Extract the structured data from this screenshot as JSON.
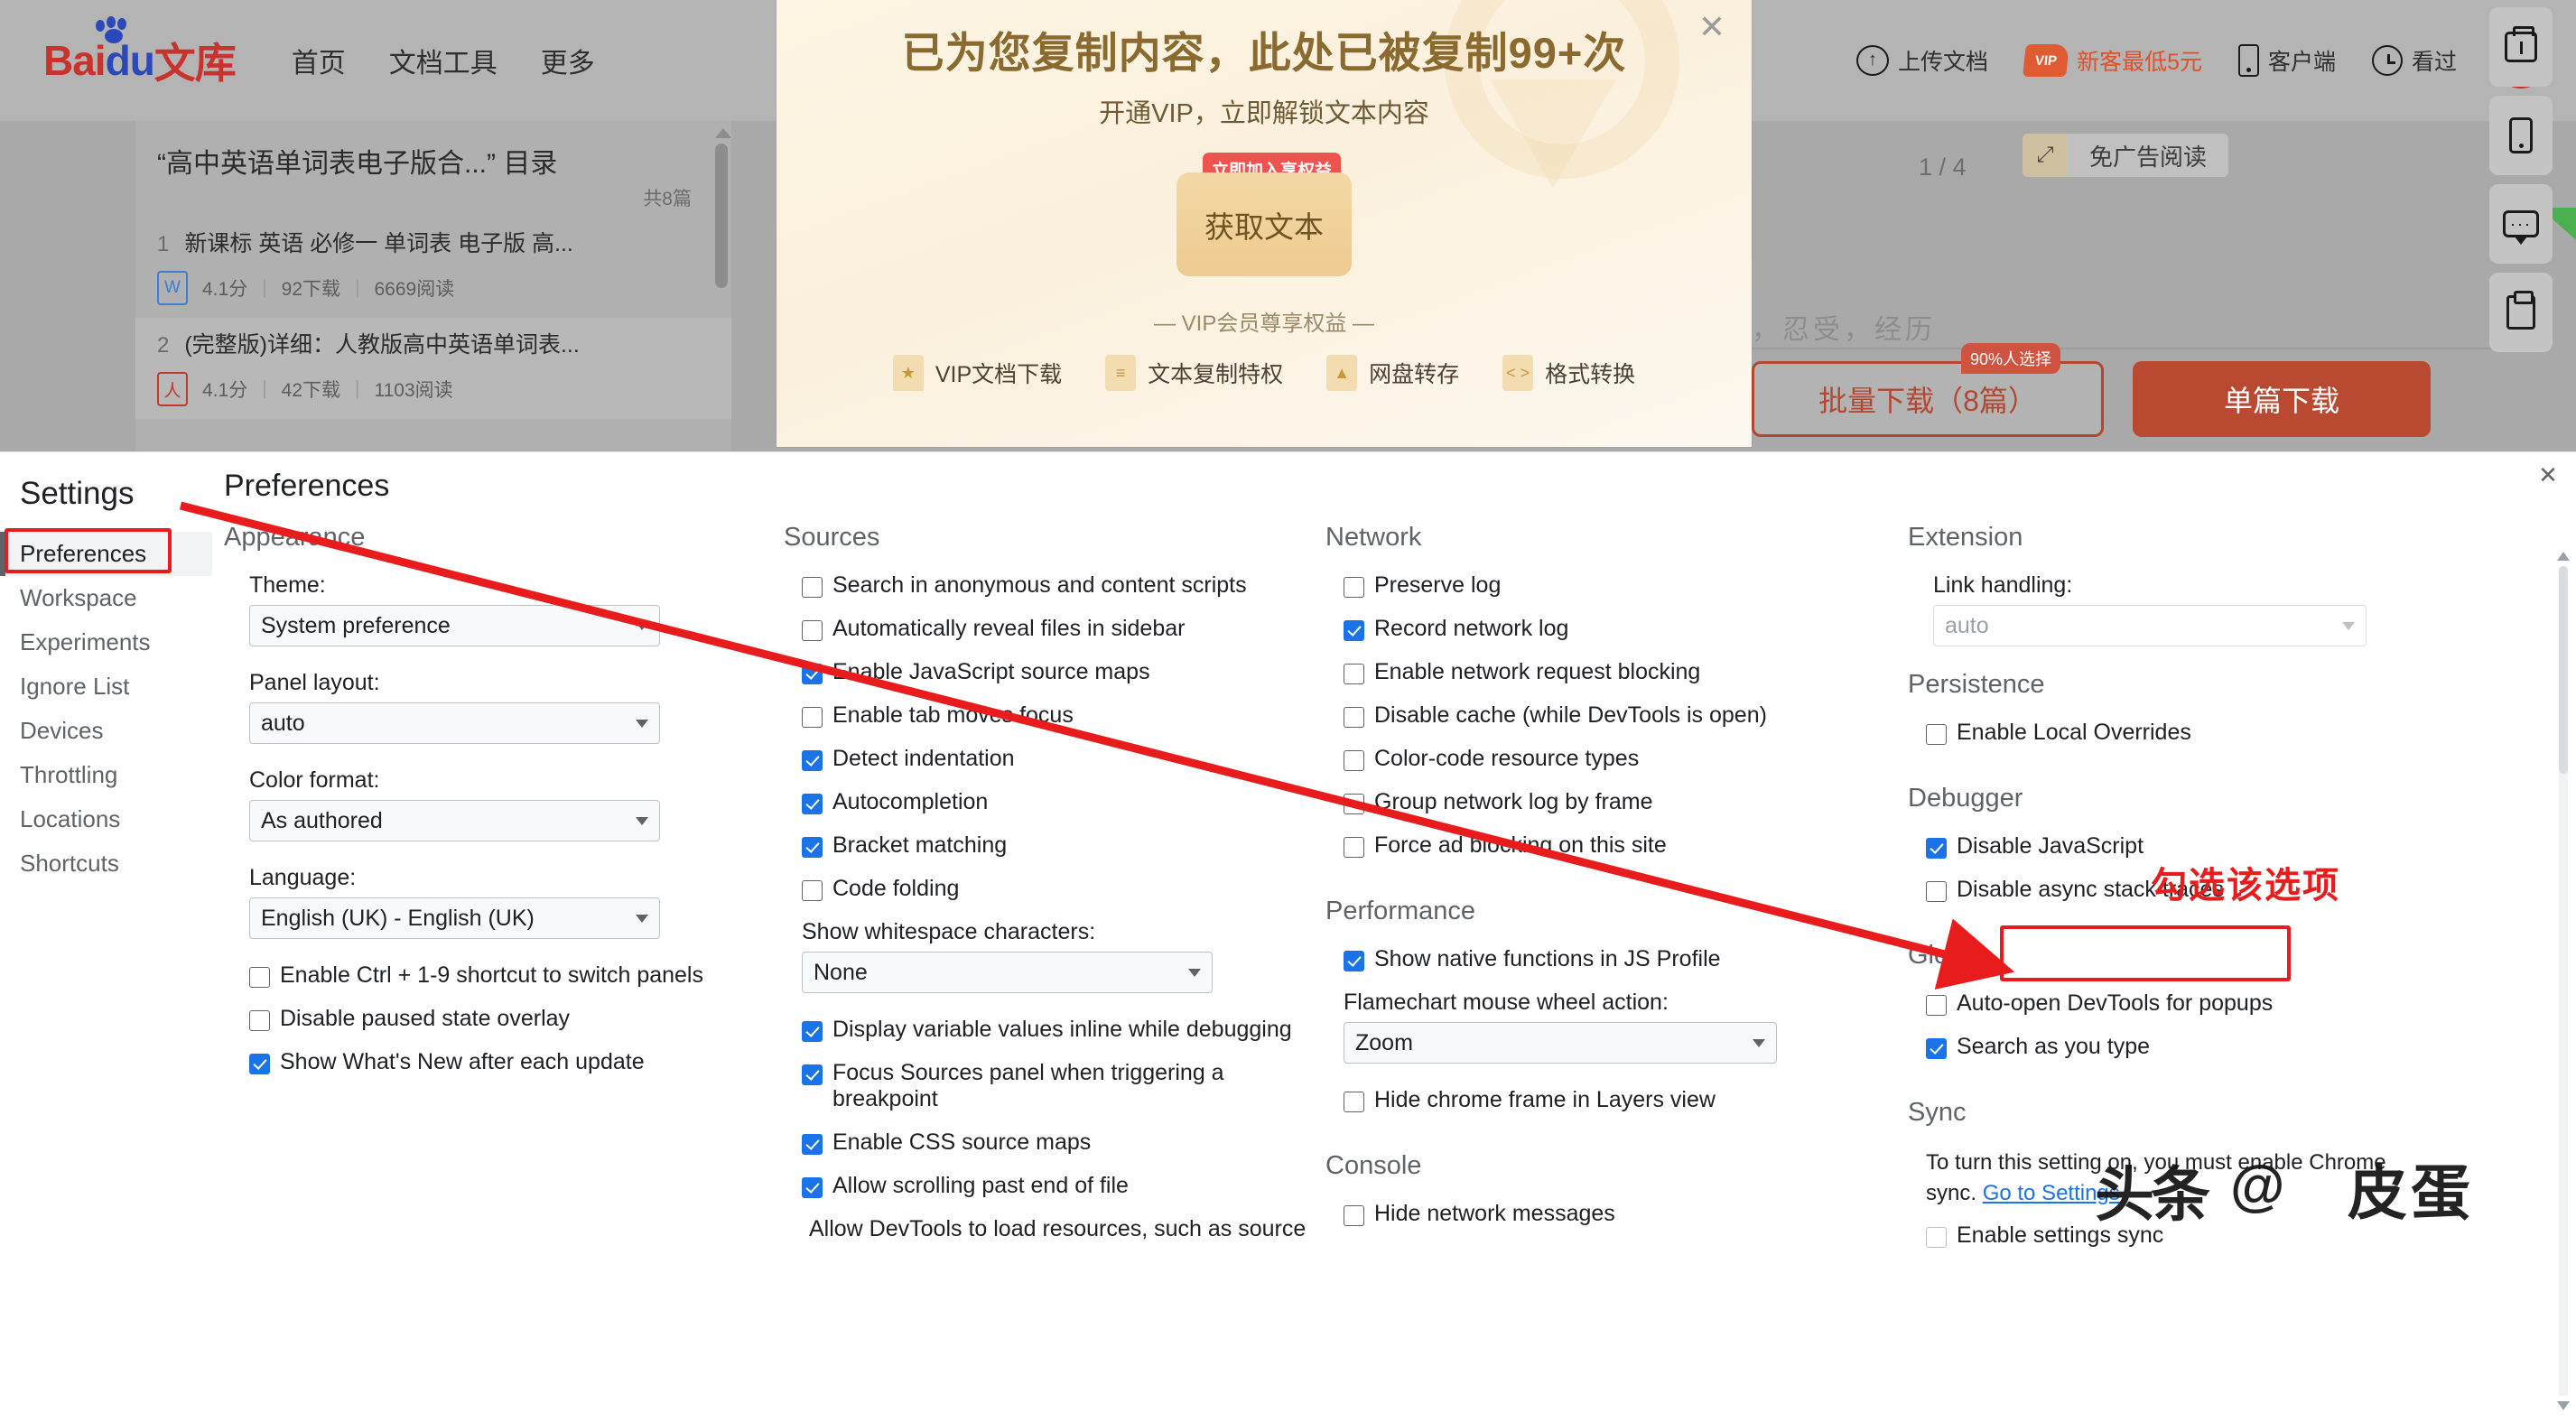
{
  "baidu": {
    "logo": {
      "bai": "Bai",
      "du": "du",
      "wenku": "文库"
    },
    "nav": [
      {
        "label": "首页"
      },
      {
        "label": "文档工具"
      },
      {
        "label": "更多"
      }
    ],
    "right_items": [
      {
        "label": "上传文档",
        "icon": "upload-cloud-icon"
      },
      {
        "label": "新客最低5元",
        "icon": "vip-tag-icon",
        "badge": "VIP"
      },
      {
        "label": "客户端",
        "icon": "phone-icon"
      },
      {
        "label": "看过",
        "icon": "clock-icon"
      }
    ],
    "doc_list": {
      "title": "“高中英语单词表电子版合...” 目录",
      "count": "共8篇",
      "items": [
        {
          "index": "1",
          "title": "新课标 英语 必修一 单词表 电子版 高...",
          "filetype": "W",
          "rating": "4.1分",
          "downloads": "92下载",
          "reads": "6669阅读"
        },
        {
          "index": "2",
          "title": "(完整版)详细：人教版高中英语单词表...",
          "filetype": "PDF",
          "rating": "4.1分",
          "downloads": "42下载",
          "reads": "1103阅读"
        }
      ]
    },
    "preview_text": "，忍受，经历",
    "page_indicator": "1 / 4",
    "adfree_button": "免广告阅读",
    "batch_download": "批量下载（8篇）",
    "batch_badge": "90%人选择",
    "single_download": "单篇下载",
    "float_tools": [
      {
        "icon": "briefcase-icon"
      },
      {
        "icon": "phone-icon"
      },
      {
        "icon": "chat-icon"
      },
      {
        "icon": "clipboard-icon"
      }
    ]
  },
  "vip_modal": {
    "title": "已为您复制内容，此处已被复制99+次",
    "subtitle": "开通VIP，立即解锁文本内容",
    "cta_label": "获取文本",
    "cta_badge": "立即加入享权益",
    "divider": "— VIP会员尊享权益 —",
    "close_icon": "close-icon",
    "benefits": [
      {
        "label": "VIP文档下载",
        "icon": "star-bookmark-icon",
        "glyph": "★"
      },
      {
        "label": "文本复制特权",
        "icon": "text-copy-icon",
        "glyph": "≡"
      },
      {
        "label": "网盘转存",
        "icon": "cloud-save-icon",
        "glyph": "▲"
      },
      {
        "label": "格式转换",
        "icon": "format-convert-icon",
        "glyph": "< >"
      }
    ]
  },
  "settings": {
    "heading": "Settings",
    "page_title": "Preferences",
    "close_icon": "close-icon",
    "nav": [
      {
        "label": "Preferences",
        "selected": true
      },
      {
        "label": "Workspace",
        "selected": false
      },
      {
        "label": "Experiments",
        "selected": false
      },
      {
        "label": "Ignore List",
        "selected": false
      },
      {
        "label": "Devices",
        "selected": false
      },
      {
        "label": "Throttling",
        "selected": false
      },
      {
        "label": "Locations",
        "selected": false
      },
      {
        "label": "Shortcuts",
        "selected": false
      }
    ],
    "appearance": {
      "section": "Appearance",
      "theme_label": "Theme:",
      "theme_value": "System preference",
      "panel_layout_label": "Panel layout:",
      "panel_layout_value": "auto",
      "color_format_label": "Color format:",
      "color_format_value": "As authored",
      "language_label": "Language:",
      "language_value": "English (UK) - English (UK)",
      "checkboxes": [
        {
          "label": "Enable Ctrl + 1-9 shortcut to switch panels",
          "checked": false
        },
        {
          "label": "Disable paused state overlay",
          "checked": false
        },
        {
          "label": "Show What's New after each update",
          "checked": true
        }
      ]
    },
    "sources": {
      "section": "Sources",
      "checkboxes_top": [
        {
          "label": "Search in anonymous and content scripts",
          "checked": false
        },
        {
          "label": "Automatically reveal files in sidebar",
          "checked": false
        },
        {
          "label": "Enable JavaScript source maps",
          "checked": true
        },
        {
          "label": "Enable tab moves focus",
          "checked": false
        },
        {
          "label": "Detect indentation",
          "checked": true
        },
        {
          "label": "Autocompletion",
          "checked": true
        },
        {
          "label": "Bracket matching",
          "checked": true
        },
        {
          "label": "Code folding",
          "checked": false
        }
      ],
      "whitespace_label": "Show whitespace characters:",
      "whitespace_value": "None",
      "checkboxes_bottom": [
        {
          "label": "Display variable values inline while debugging",
          "checked": true
        },
        {
          "label": "Focus Sources panel when triggering a breakpoint",
          "checked": true
        },
        {
          "label": "Enable CSS source maps",
          "checked": true
        },
        {
          "label": "Allow scrolling past end of file",
          "checked": true
        }
      ],
      "truncated_label": "Allow DevTools to load resources, such as source"
    },
    "network": {
      "section": "Network",
      "checkboxes": [
        {
          "label": "Preserve log",
          "checked": false
        },
        {
          "label": "Record network log",
          "checked": true
        },
        {
          "label": "Enable network request blocking",
          "checked": false
        },
        {
          "label": "Disable cache (while DevTools is open)",
          "checked": false
        },
        {
          "label": "Color-code resource types",
          "checked": false
        },
        {
          "label": "Group network log by frame",
          "checked": false
        },
        {
          "label": "Force ad blocking on this site",
          "checked": false
        }
      ]
    },
    "performance": {
      "section": "Performance",
      "checkbox_native": {
        "label": "Show native functions in JS Profile",
        "checked": true
      },
      "flamechart_label": "Flamechart mouse wheel action:",
      "flamechart_value": "Zoom",
      "checkbox_hide_chrome": {
        "label": "Hide chrome frame in Layers view",
        "checked": false
      }
    },
    "console": {
      "section": "Console",
      "checkboxes": [
        {
          "label": "Hide network messages",
          "checked": false
        }
      ]
    },
    "extension": {
      "section": "Extension",
      "link_handling_label": "Link handling:",
      "link_handling_value": "auto"
    },
    "persistence": {
      "section": "Persistence",
      "checkboxes": [
        {
          "label": "Enable Local Overrides",
          "checked": false
        }
      ]
    },
    "debugger": {
      "section": "Debugger",
      "checkboxes": [
        {
          "label": "Disable JavaScript",
          "checked": true
        },
        {
          "label": "Disable async stack traces",
          "checked": false
        }
      ]
    },
    "global": {
      "section": "Global",
      "checkboxes": [
        {
          "label": "Auto-open DevTools for popups",
          "checked": false
        },
        {
          "label": "Search as you type",
          "checked": true
        }
      ]
    },
    "sync": {
      "section": "Sync",
      "note_prefix": "To turn this setting on, you must enable Chrome sync. ",
      "note_link": "Go to Settings",
      "checkbox": {
        "label": "Enable settings sync",
        "checked": false
      }
    }
  },
  "annotation": {
    "text": "勾选该选项",
    "color": "#e81c1c"
  },
  "watermark": {
    "part1": "头条",
    "part2": "@",
    "part3": "皮蛋"
  }
}
